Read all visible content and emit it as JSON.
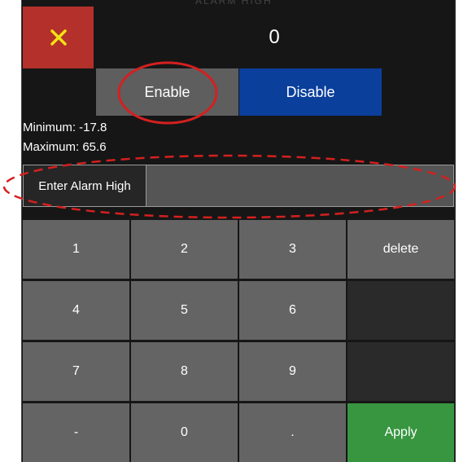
{
  "header": {
    "background_title": "ALARM HIGH",
    "close_icon": "close-x-icon",
    "close_icon_color": "#f2e313",
    "value": "0"
  },
  "toggle": {
    "enable_label": "Enable",
    "disable_label": "Disable"
  },
  "range": {
    "minimum_text": "Minimum: -17.8",
    "maximum_text": "Maximum: 65.6"
  },
  "input": {
    "label": "Enter Alarm High",
    "value": ""
  },
  "keypad": {
    "k1": "1",
    "k2": "2",
    "k3": "3",
    "delete": "delete",
    "k4": "4",
    "k5": "5",
    "k6": "6",
    "k7": "7",
    "k8": "8",
    "k9": "9",
    "minus": "-",
    "k0": "0",
    "dot": ".",
    "apply": "Apply"
  },
  "colors": {
    "close_bg": "#b3302b",
    "enable_bg": "#5e5e5e",
    "disable_bg": "#0a3f9c",
    "apply_bg": "#37963f",
    "annotation_red": "#d42020"
  }
}
